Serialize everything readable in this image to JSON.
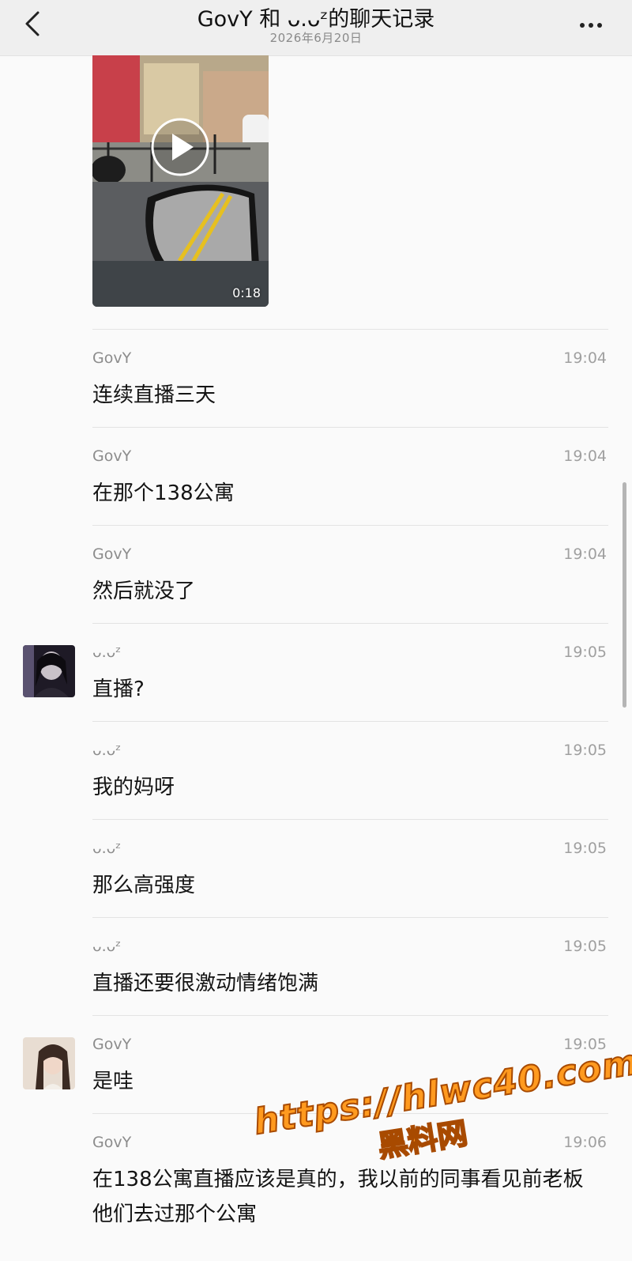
{
  "header": {
    "title": "GovY 和 ᴗ.ᴗᶻ的聊天记录",
    "subtitle": "2026年6月20日"
  },
  "video": {
    "duration": "0:18"
  },
  "messages": [
    {
      "sender": "GovY",
      "time": "19:04",
      "text": "连续直播三天",
      "avatar": null
    },
    {
      "sender": "GovY",
      "time": "19:04",
      "text": "在那个138公寓",
      "avatar": null
    },
    {
      "sender": "GovY",
      "time": "19:04",
      "text": "然后就没了",
      "avatar": null
    },
    {
      "sender": "ᴗ.ᴗᶻ",
      "time": "19:05",
      "text": "直播?",
      "avatar": "dark-portrait"
    },
    {
      "sender": "ᴗ.ᴗᶻ",
      "time": "19:05",
      "text": "我的妈呀",
      "avatar": null
    },
    {
      "sender": "ᴗ.ᴗᶻ",
      "time": "19:05",
      "text": "那么高强度",
      "avatar": null
    },
    {
      "sender": "ᴗ.ᴗᶻ",
      "time": "19:05",
      "text": "直播还要很激动情绪饱满",
      "avatar": null
    },
    {
      "sender": "GovY",
      "time": "19:05",
      "text": "是哇",
      "avatar": "light-portrait"
    },
    {
      "sender": "GovY",
      "time": "19:06",
      "text": "在138公寓直播应该是真的，我以前的同事看见前老板他们去过那个公寓",
      "avatar": null
    }
  ],
  "watermark": {
    "url": "https://hlwc40.com",
    "name": "黑料网"
  },
  "icons": {
    "back": "chevron-left-icon",
    "more": "more-dots-icon",
    "play": "play-icon"
  }
}
